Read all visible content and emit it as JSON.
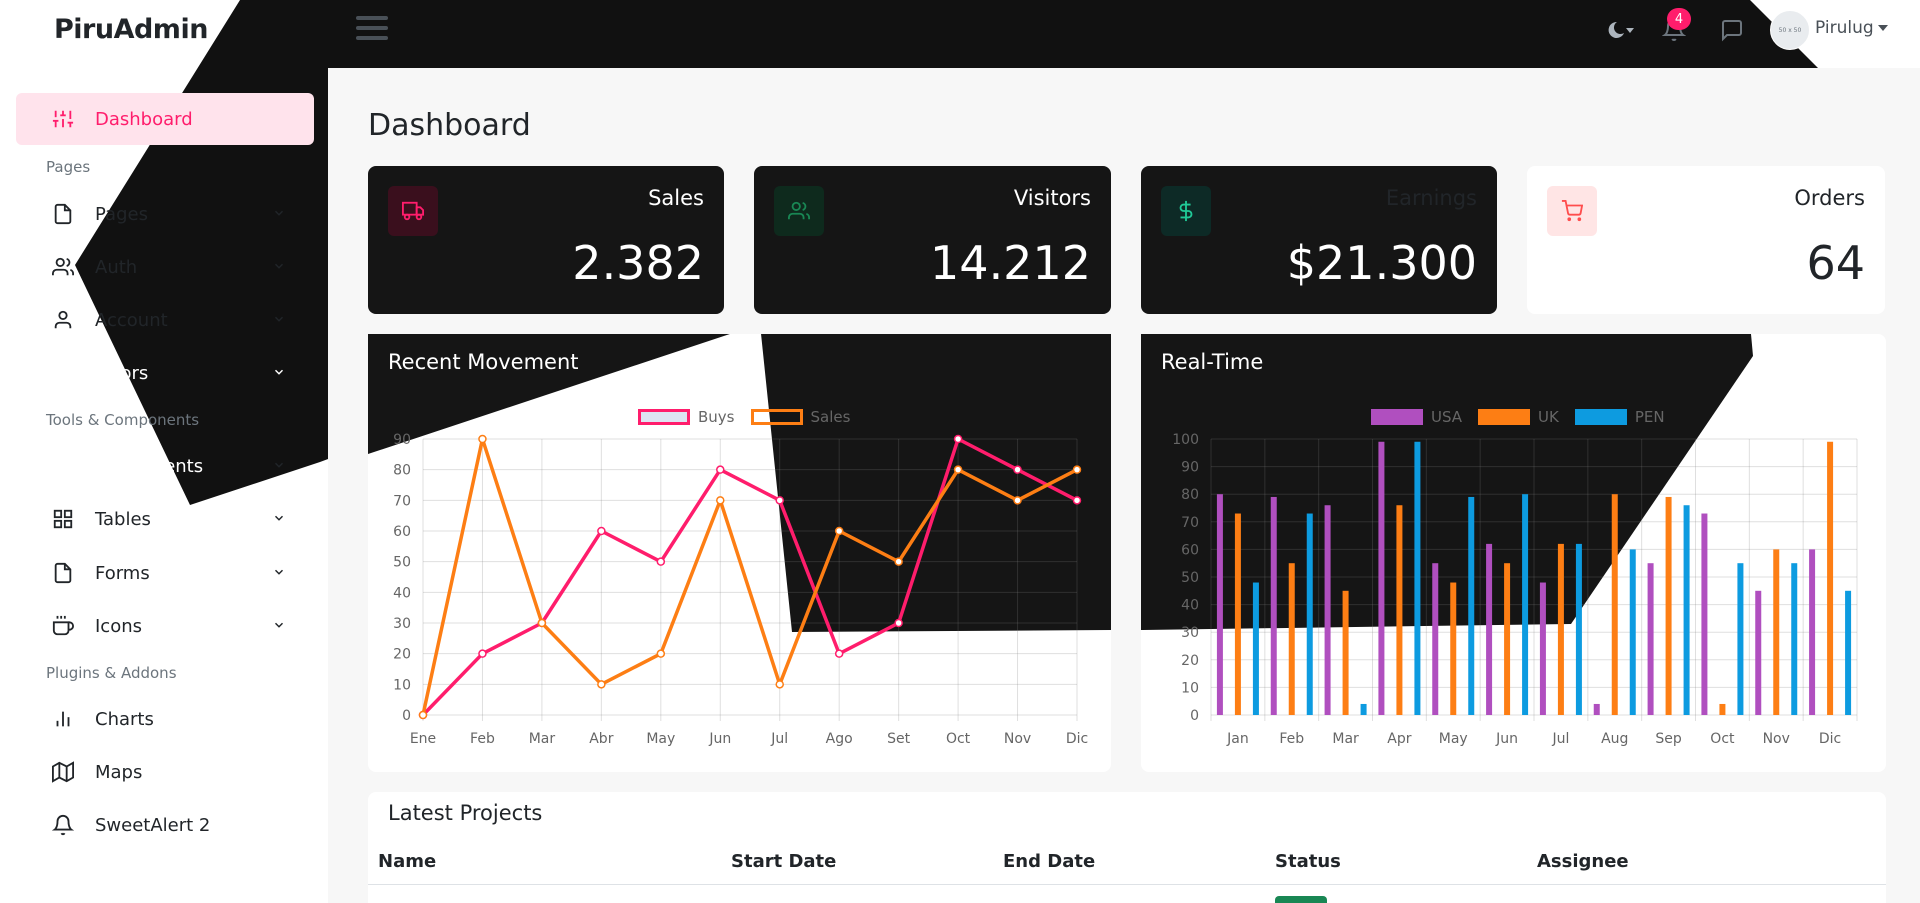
{
  "brand": "PiruAdmin",
  "sidebar": {
    "active": "Dashboard",
    "sections": [
      "Pages",
      "Tools & Components",
      "Plugins & Addons"
    ],
    "items": [
      {
        "label": "Dashboard",
        "icon": "sliders-icon"
      },
      {
        "label": "Pages",
        "icon": "file-icon"
      },
      {
        "label": "Auth",
        "icon": "users-icon"
      },
      {
        "label": "Account",
        "icon": "user-icon"
      },
      {
        "label": "Errors",
        "icon": "coffee-icon"
      },
      {
        "label": "UI Elements",
        "icon": "users-icon"
      },
      {
        "label": "Tables",
        "icon": "grid-icon"
      },
      {
        "label": "Forms",
        "icon": "file-icon"
      },
      {
        "label": "Icons",
        "icon": "coffee-icon"
      },
      {
        "label": "Charts",
        "icon": "bar-chart-icon"
      },
      {
        "label": "Maps",
        "icon": "map-icon"
      },
      {
        "label": "SweetAlert 2",
        "icon": "bell-icon"
      }
    ]
  },
  "topbar": {
    "notifications_count": "4",
    "avatar_text": "50 x 50",
    "username": "Pirulug"
  },
  "page_title": "Dashboard",
  "stats": [
    {
      "title": "Sales",
      "value": "2.382",
      "icon": "truck-icon",
      "color": "#ff1d6c"
    },
    {
      "title": "Visitors",
      "value": "14.212",
      "icon": "users-icon",
      "color": "#198754"
    },
    {
      "title": "Earnings",
      "value": "$21.300",
      "icon": "dollar-icon",
      "color": "#20c997"
    },
    {
      "title": "Orders",
      "value": "64",
      "icon": "cart-icon",
      "color": "#ff4d4d"
    }
  ],
  "charts": {
    "recent_title": "Recent Movement",
    "realtime_title": "Real-Time"
  },
  "chart_data": [
    {
      "type": "line",
      "x": [
        "Ene",
        "Feb",
        "Mar",
        "Abr",
        "May",
        "Jun",
        "Jul",
        "Ago",
        "Set",
        "Oct",
        "Nov",
        "Dic"
      ],
      "series": [
        {
          "name": "Buys",
          "color": "#ff1d6c",
          "values": [
            0,
            20,
            30,
            60,
            50,
            80,
            70,
            20,
            30,
            90,
            80,
            70
          ]
        },
        {
          "name": "Sales",
          "color": "#fd7e14",
          "values": [
            0,
            90,
            30,
            10,
            20,
            70,
            10,
            60,
            50,
            80,
            70,
            80
          ]
        }
      ],
      "ylim": [
        0,
        90
      ],
      "yticks": [
        0,
        10,
        20,
        30,
        40,
        50,
        60,
        70,
        80,
        90
      ],
      "grid": true,
      "legend": "top-center"
    },
    {
      "type": "bar",
      "categories": [
        "Jan",
        "Feb",
        "Mar",
        "Apr",
        "May",
        "Jun",
        "Jul",
        "Aug",
        "Sep",
        "Oct",
        "Nov",
        "Dic"
      ],
      "series": [
        {
          "name": "USA",
          "color": "#b04fbf",
          "values": [
            80,
            79,
            76,
            99,
            55,
            62,
            48,
            4,
            55,
            73,
            45,
            60
          ]
        },
        {
          "name": "UK",
          "color": "#fd7e14",
          "values": [
            73,
            55,
            45,
            76,
            48,
            55,
            62,
            80,
            79,
            4,
            60,
            99
          ]
        },
        {
          "name": "PEN",
          "color": "#0d9be0",
          "values": [
            48,
            73,
            4,
            99,
            79,
            80,
            62,
            60,
            76,
            55,
            55,
            45
          ]
        }
      ],
      "ylim": [
        0,
        100
      ],
      "yticks": [
        0,
        10,
        20,
        30,
        40,
        50,
        60,
        70,
        80,
        90,
        100
      ],
      "grid": true,
      "legend": "top-center"
    }
  ],
  "projects": {
    "title": "Latest Projects",
    "columns": [
      "Name",
      "Start Date",
      "End Date",
      "Status",
      "Assignee"
    ]
  }
}
